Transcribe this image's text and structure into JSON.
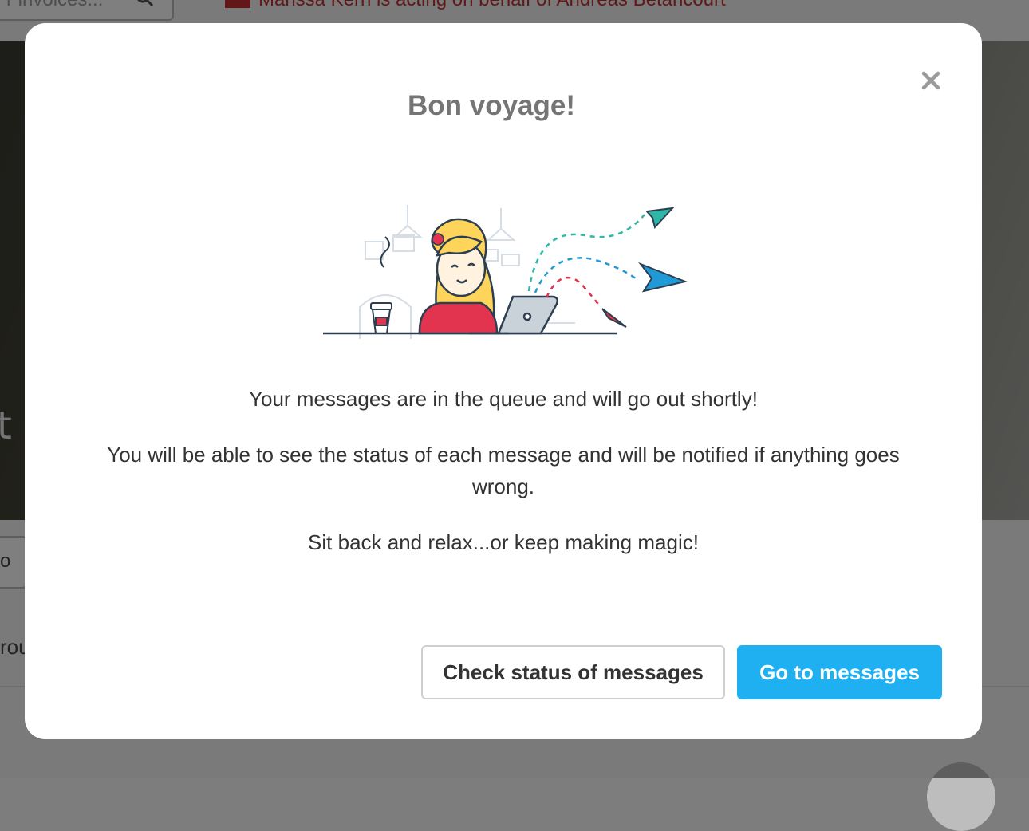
{
  "background": {
    "search_placeholder": "r invoices...",
    "banner_text": "Marissa Kern is acting on behalf of Andreas Betancourt",
    "hero_text_fragment": "t",
    "field_fragment": "o",
    "section_fragment": "rou"
  },
  "modal": {
    "title": "Bon voyage!",
    "close_icon": "close-icon",
    "illustration": "woman-laptop-paper-planes-illustration",
    "message_1": "Your messages are in the queue and will go out shortly!",
    "message_2": "You will be able to see the status of each message and will be notified if anything goes wrong.",
    "message_3": "Sit back and relax...or keep making magic!",
    "secondary_button": "Check status of messages",
    "primary_button": "Go to messages"
  },
  "colors": {
    "primary": "#1fb0f2",
    "title": "#757575",
    "text": "#333333",
    "banner": "#c53030"
  }
}
